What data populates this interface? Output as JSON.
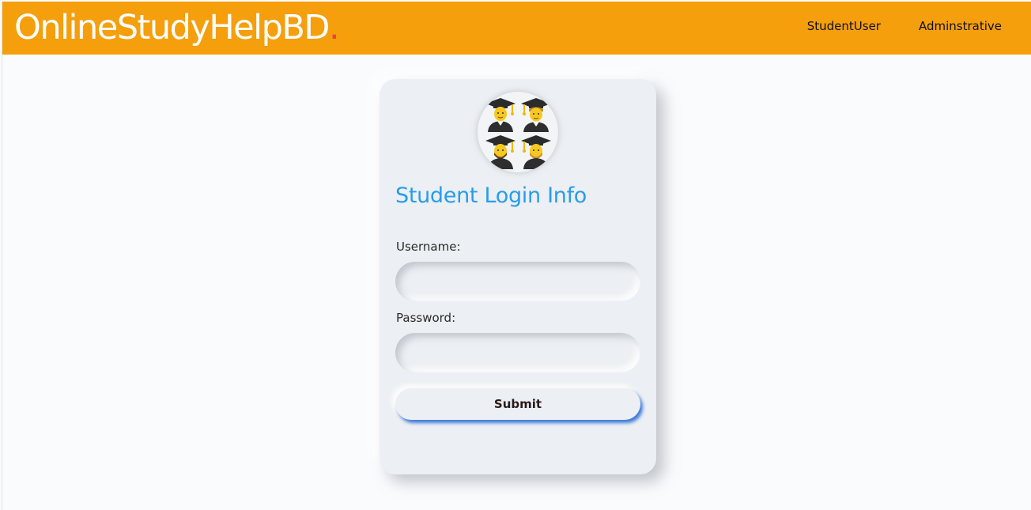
{
  "navbar": {
    "brand": "OnlineStudyHelpBD",
    "brand_dot": ".",
    "links": [
      {
        "label": "StudentUser"
      },
      {
        "label": "Adminstrative"
      }
    ]
  },
  "login_card": {
    "avatar_icon": "graduate-students-icon",
    "title": "Student Login Info",
    "username": {
      "label": "Username:",
      "value": "",
      "placeholder": ""
    },
    "password": {
      "label": "Password:",
      "value": "",
      "placeholder": ""
    },
    "submit_label": "Submit"
  },
  "colors": {
    "navbar_bg": "#f59f0c",
    "brand_dot": "#e8453c",
    "title": "#279cf0",
    "card_bg": "#eceff3",
    "button_shadow": "#3d7bd8"
  }
}
